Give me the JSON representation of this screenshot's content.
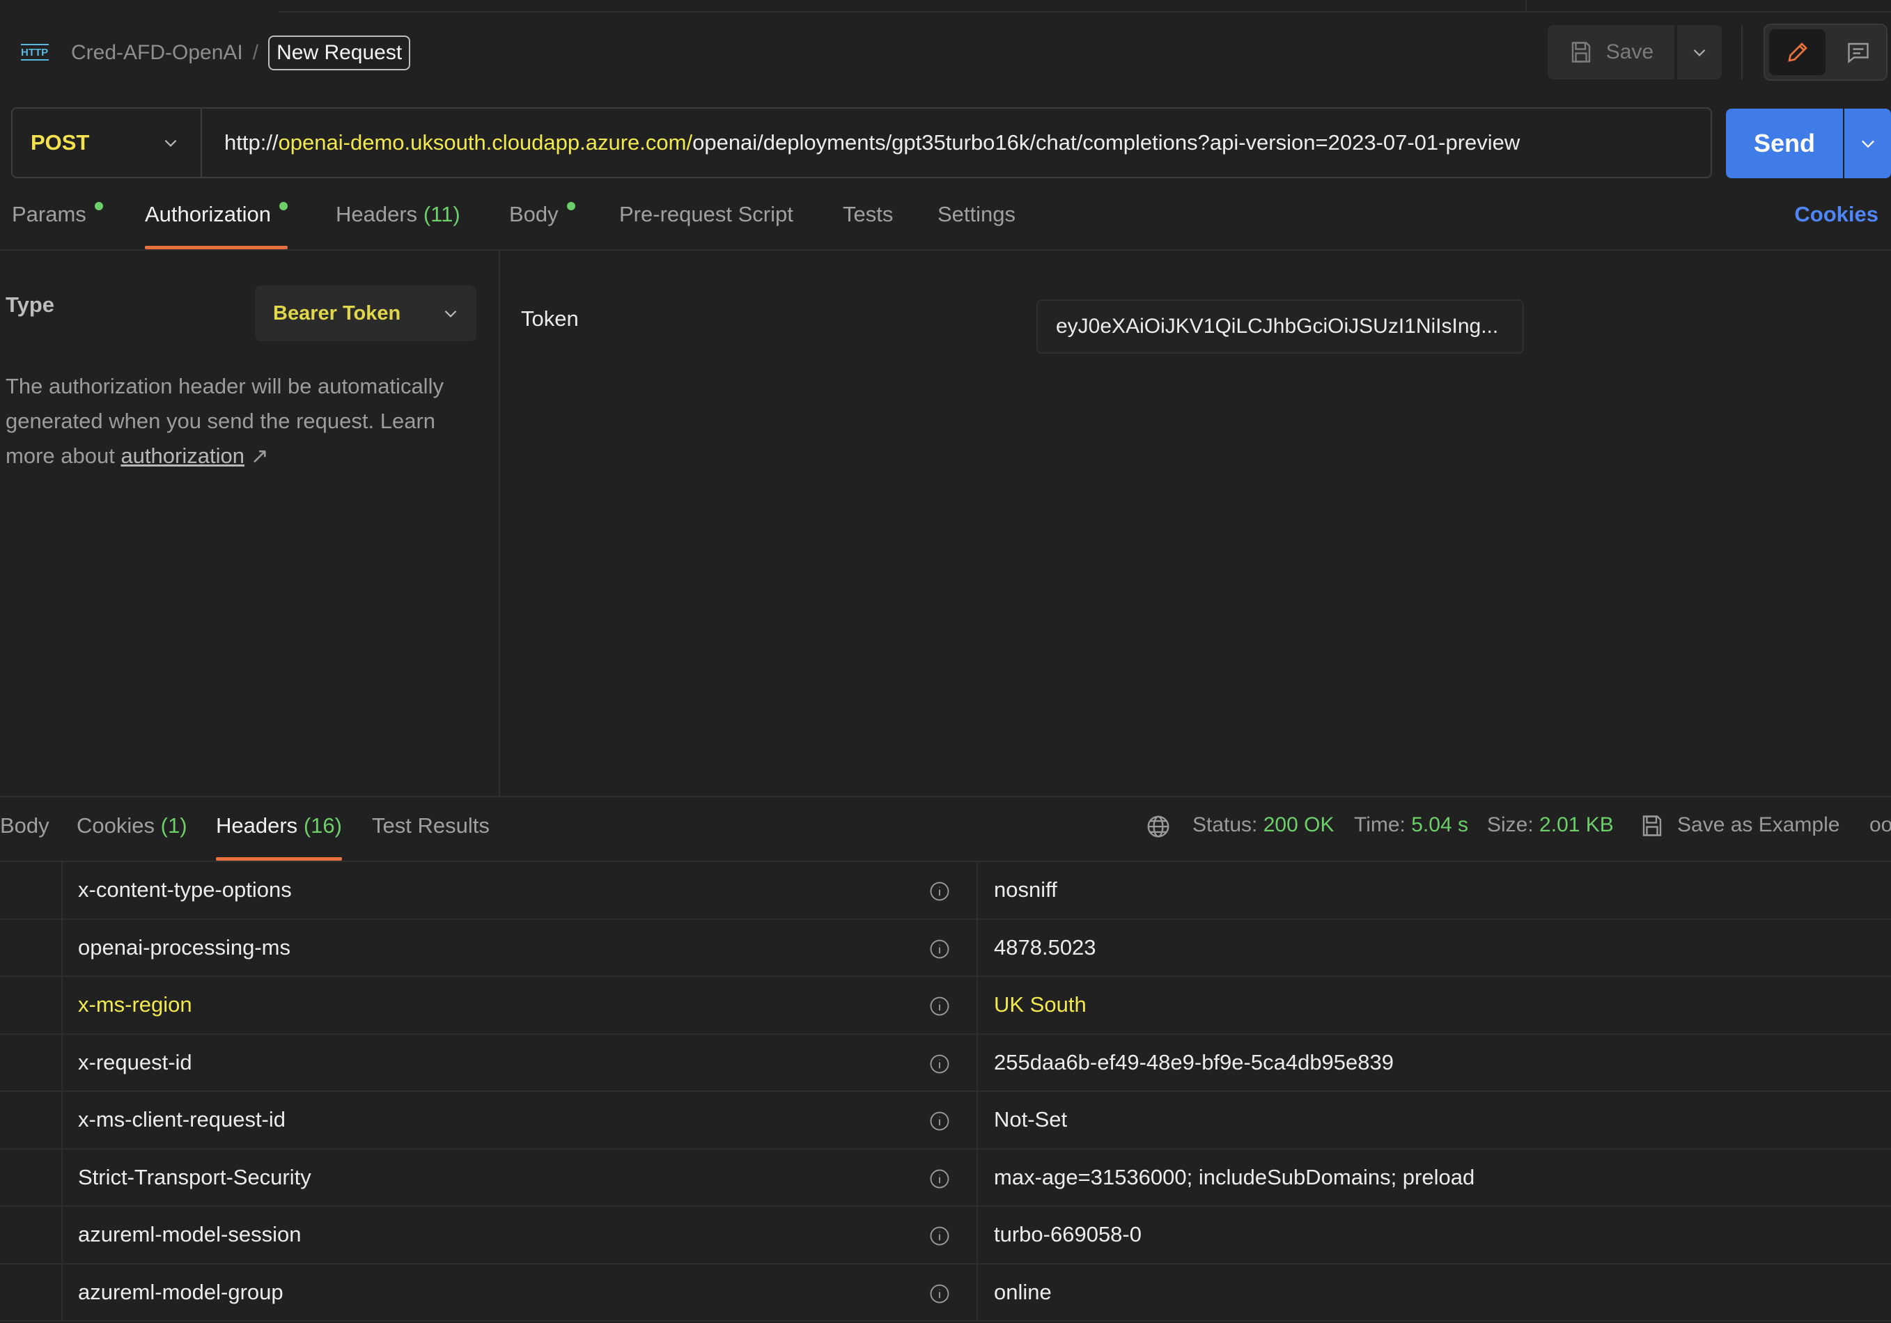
{
  "breadcrumb": {
    "collection": "Cred-AFD-OpenAI",
    "separator": "/",
    "request_name": "New Request"
  },
  "toolbar": {
    "save_label": "Save",
    "icons": [
      "http-icon",
      "save-icon",
      "chevron-down-icon",
      "pencil-icon",
      "comment-icon"
    ]
  },
  "request": {
    "method": "POST",
    "url_prefix": "http://",
    "url_host": "openai-demo.uksouth.cloudapp.azure.com/",
    "url_path": "openai/deployments/gpt35turbo16k/chat/completions?api-version=2023-07-01-preview",
    "send_label": "Send"
  },
  "request_tabs": [
    {
      "label": "Params",
      "dot": true
    },
    {
      "label": "Authorization",
      "dot": true,
      "active": true
    },
    {
      "label": "Headers",
      "count": "(11)"
    },
    {
      "label": "Body",
      "dot": true
    },
    {
      "label": "Pre-request Script"
    },
    {
      "label": "Tests"
    },
    {
      "label": "Settings"
    }
  ],
  "cookies_link": "Cookies",
  "auth": {
    "type_label": "Type",
    "type_value": "Bearer Token",
    "description_1": "The authorization header will be automatically",
    "description_2": "generated when you send the request. Learn",
    "description_3": "more about ",
    "description_link": "authorization",
    "link_arrow": "↗",
    "token_label": "Token",
    "token_value": "eyJ0eXAiOiJKV1QiLCJhbGciOiJSUzI1NiIsIng..."
  },
  "response_tabs": [
    {
      "label": "Body"
    },
    {
      "label": "Cookies",
      "count": "(1)"
    },
    {
      "label": "Headers",
      "count": "(16)",
      "active": true
    },
    {
      "label": "Test Results"
    }
  ],
  "response_meta": {
    "status_label": "Status:",
    "status_value": "200 OK",
    "time_label": "Time:",
    "time_value": "5.04 s",
    "size_label": "Size:",
    "size_value": "2.01 KB",
    "save_example_label": "Save as Example",
    "more": "ooo"
  },
  "response_headers": [
    {
      "key": "x-content-type-options",
      "value": "nosniff"
    },
    {
      "key": "openai-processing-ms",
      "value": "4878.5023"
    },
    {
      "key": "x-ms-region",
      "value": "UK South",
      "highlight": true
    },
    {
      "key": "x-request-id",
      "value": "255daa6b-ef49-48e9-bf9e-5ca4db95e839"
    },
    {
      "key": "x-ms-client-request-id",
      "value": "Not-Set"
    },
    {
      "key": "Strict-Transport-Security",
      "value": "max-age=31536000; includeSubDomains; preload"
    },
    {
      "key": "azureml-model-session",
      "value": "turbo-669058-0"
    },
    {
      "key": "azureml-model-group",
      "value": "online"
    }
  ],
  "colors": {
    "background": "#212121",
    "method": "#f3e24e",
    "highlight": "#f2e94e",
    "success": "#6ccf6a",
    "accent_blue": "#3f7ce8",
    "tab_underline": "#e8723d"
  }
}
